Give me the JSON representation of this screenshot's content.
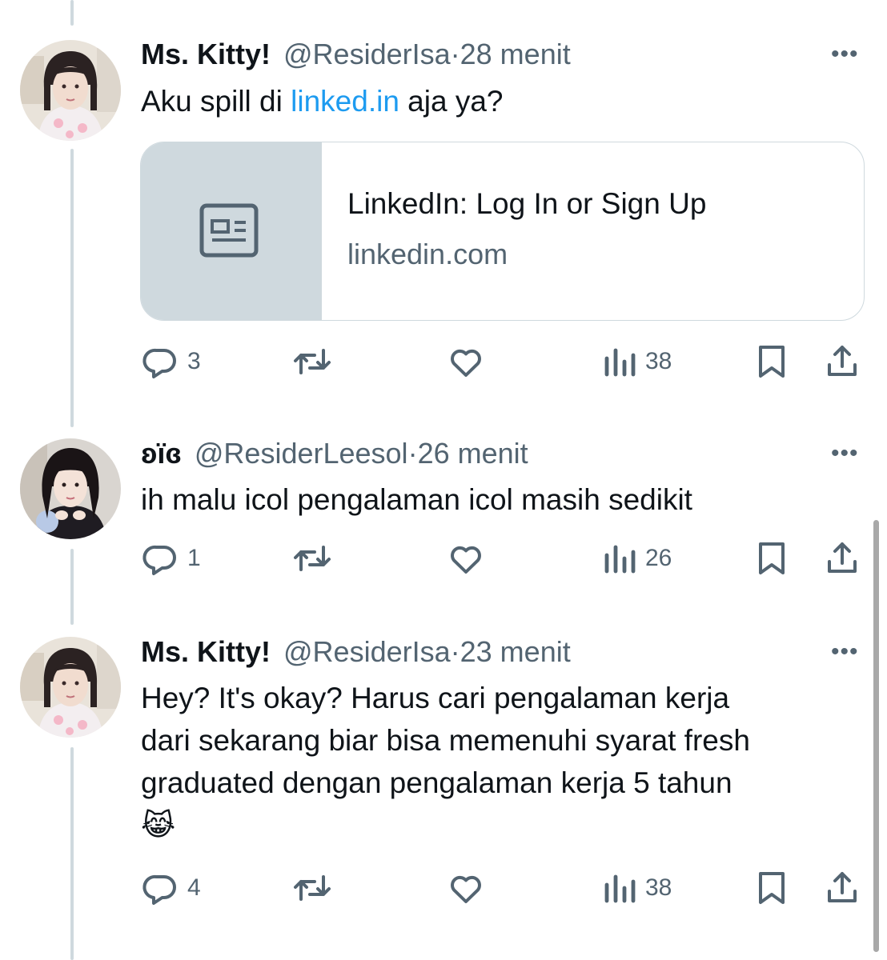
{
  "tweets": [
    {
      "display_name": "Ms. Kitty!",
      "handle": "@ResiderIsa",
      "separator": "·",
      "time": "28 menit",
      "more": "•••",
      "text_before": "Aku spill di ",
      "text_link": "linked.in",
      "text_after": " aja ya?",
      "card": {
        "title": "LinkedIn: Log In or Sign Up",
        "domain": "linkedin.com"
      },
      "actions": {
        "replies": "3",
        "retweets": "",
        "likes": "",
        "views": "38"
      }
    },
    {
      "display_name": "ʚïɞ",
      "handle": "@ResiderLeesol",
      "separator": "·",
      "time": "26 menit",
      "more": "•••",
      "text": "ih malu icol pengalaman icol masih sedikit",
      "actions": {
        "replies": "1",
        "retweets": "",
        "likes": "",
        "views": "26"
      }
    },
    {
      "display_name": "Ms. Kitty!",
      "handle": "@ResiderIsa",
      "separator": "·",
      "time": "23 menit",
      "more": "•••",
      "text_lines": [
        "Hey? It's okay? Harus cari pengalaman kerja",
        "dari sekarang biar bisa memenuhi syarat fresh",
        "graduated dengan pengalaman kerja 5 tahun",
        "😹"
      ],
      "actions": {
        "replies": "4",
        "retweets": "",
        "likes": "",
        "views": "38"
      }
    }
  ],
  "colors": {
    "text": "#0f1419",
    "secondary": "#536471",
    "link": "#1d9bf0",
    "thread_line": "#cfd9de",
    "card_border": "#cfd9de"
  },
  "icons": [
    "reply-icon",
    "retweet-icon",
    "like-icon",
    "views-icon",
    "bookmark-icon",
    "share-icon",
    "article-icon",
    "more-icon"
  ]
}
